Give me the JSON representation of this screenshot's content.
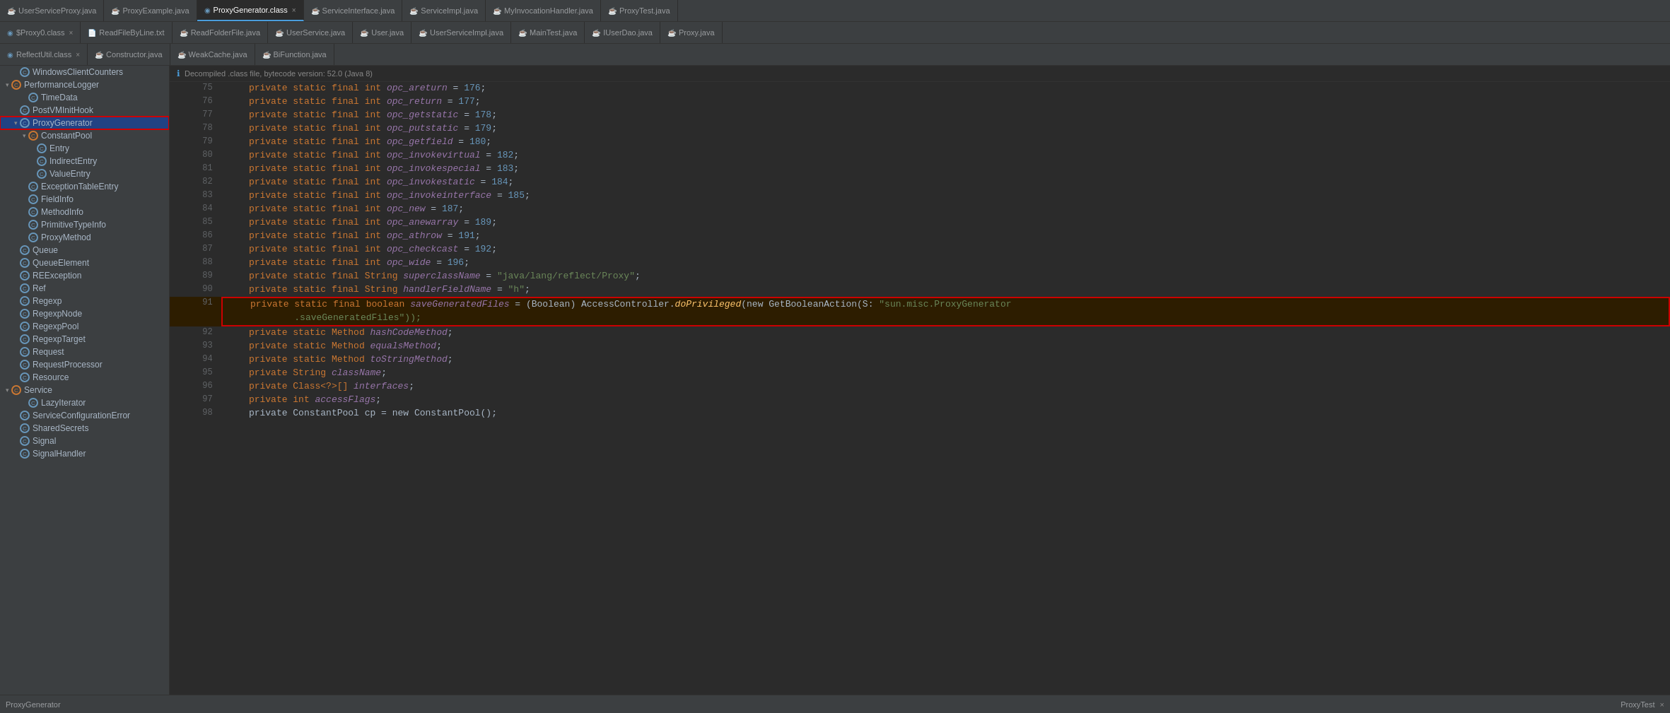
{
  "tabs_row1": [
    {
      "label": "UserServiceProxy.java",
      "icon": "java",
      "active": false,
      "closeable": false
    },
    {
      "label": "ProxyExample.java",
      "icon": "java",
      "active": false,
      "closeable": false
    },
    {
      "label": "ProxyGenerator.class",
      "icon": "class",
      "active": true,
      "closeable": true
    },
    {
      "label": "ServiceInterface.java",
      "icon": "java",
      "active": false,
      "closeable": false
    },
    {
      "label": "ServiceImpl.java",
      "icon": "java",
      "active": false,
      "closeable": false
    },
    {
      "label": "MyInvocationHandler.java",
      "icon": "java",
      "active": false,
      "closeable": false
    },
    {
      "label": "ProxyTest.java",
      "icon": "java",
      "active": false,
      "closeable": false
    }
  ],
  "tabs_row2": [
    {
      "label": "$Proxy0.class",
      "icon": "class",
      "active": false,
      "closeable": true
    },
    {
      "label": "ReadFileByLine.txt",
      "icon": "txt",
      "active": false,
      "closeable": false
    },
    {
      "label": "ReadFolderFile.java",
      "icon": "java",
      "active": false,
      "closeable": false
    },
    {
      "label": "UserService.java",
      "icon": "java",
      "active": false,
      "closeable": false
    },
    {
      "label": "User.java",
      "icon": "java",
      "active": false,
      "closeable": false
    },
    {
      "label": "UserServiceImpl.java",
      "icon": "java",
      "active": false,
      "closeable": false
    },
    {
      "label": "MainTest.java",
      "icon": "java",
      "active": false,
      "closeable": false
    },
    {
      "label": "IUserDao.java",
      "icon": "java",
      "active": false,
      "closeable": false
    },
    {
      "label": "Proxy.java",
      "icon": "java",
      "active": false,
      "closeable": false
    }
  ],
  "tabs_row3": [
    {
      "label": "ReflectUtil.class",
      "icon": "class",
      "active": false,
      "closeable": true
    },
    {
      "label": "Constructor.java",
      "icon": "java",
      "active": false,
      "closeable": false
    },
    {
      "label": "WeakCache.java",
      "icon": "java",
      "active": false,
      "closeable": false
    },
    {
      "label": "BiFunction.java",
      "icon": "java",
      "active": false,
      "closeable": false
    }
  ],
  "decompile_notice": "Decompiled .class file, bytecode version: 52.0 (Java 8)",
  "sidebar": {
    "items": [
      {
        "label": "WindowsClientCounters",
        "level": 1,
        "type": "class",
        "expanded": false
      },
      {
        "label": "PerformanceLogger",
        "level": 0,
        "type": "folder",
        "expanded": true
      },
      {
        "label": "TimeData",
        "level": 2,
        "type": "class",
        "expanded": false
      },
      {
        "label": "PostVMInitHook",
        "level": 1,
        "type": "class",
        "expanded": false
      },
      {
        "label": "ProxyGenerator",
        "level": 1,
        "type": "class",
        "expanded": true,
        "selected": true,
        "highlighted": true
      },
      {
        "label": "ConstantPool",
        "level": 2,
        "type": "folder",
        "expanded": true
      },
      {
        "label": "Entry",
        "level": 3,
        "type": "class",
        "expanded": false
      },
      {
        "label": "IndirectEntry",
        "level": 3,
        "type": "class",
        "expanded": false
      },
      {
        "label": "ValueEntry",
        "level": 3,
        "type": "class",
        "expanded": false
      },
      {
        "label": "ExceptionTableEntry",
        "level": 2,
        "type": "class",
        "expanded": false
      },
      {
        "label": "FieldInfo",
        "level": 2,
        "type": "class",
        "expanded": false
      },
      {
        "label": "MethodInfo",
        "level": 2,
        "type": "class",
        "expanded": false
      },
      {
        "label": "PrimitiveTypeInfo",
        "level": 2,
        "type": "class",
        "expanded": false
      },
      {
        "label": "ProxyMethod",
        "level": 2,
        "type": "class",
        "expanded": false
      },
      {
        "label": "Queue",
        "level": 1,
        "type": "class",
        "expanded": false
      },
      {
        "label": "QueueElement",
        "level": 1,
        "type": "class",
        "expanded": false
      },
      {
        "label": "REException",
        "level": 1,
        "type": "class",
        "expanded": false
      },
      {
        "label": "Ref",
        "level": 1,
        "type": "class",
        "expanded": false
      },
      {
        "label": "Regexp",
        "level": 1,
        "type": "class",
        "expanded": false
      },
      {
        "label": "RegexpNode",
        "level": 1,
        "type": "class",
        "expanded": false
      },
      {
        "label": "RegexpPool",
        "level": 1,
        "type": "class",
        "expanded": false
      },
      {
        "label": "RegexpTarget",
        "level": 1,
        "type": "class",
        "expanded": false
      },
      {
        "label": "Request",
        "level": 1,
        "type": "class",
        "expanded": false
      },
      {
        "label": "RequestProcessor",
        "level": 1,
        "type": "class",
        "expanded": false
      },
      {
        "label": "Resource",
        "level": 1,
        "type": "class",
        "expanded": false
      },
      {
        "label": "Service",
        "level": 0,
        "type": "folder",
        "expanded": true
      },
      {
        "label": "LazyIterator",
        "level": 2,
        "type": "class",
        "expanded": false
      },
      {
        "label": "ServiceConfigurationError",
        "level": 1,
        "type": "class",
        "expanded": false
      },
      {
        "label": "SharedSecrets",
        "level": 1,
        "type": "class",
        "expanded": false
      },
      {
        "label": "Signal",
        "level": 1,
        "type": "class",
        "expanded": false
      },
      {
        "label": "SignalHandler",
        "level": 1,
        "type": "class",
        "expanded": false
      }
    ]
  },
  "code_lines": [
    {
      "num": 75,
      "tokens": [
        {
          "t": "    private static final int ",
          "c": "kw"
        },
        {
          "t": "opc_areturn",
          "c": "field"
        },
        {
          "t": " = ",
          "c": ""
        },
        {
          "t": "176",
          "c": "num"
        },
        {
          "t": ";",
          "c": ""
        }
      ]
    },
    {
      "num": 76,
      "tokens": [
        {
          "t": "    private static final int ",
          "c": "kw"
        },
        {
          "t": "opc_return",
          "c": "field"
        },
        {
          "t": " = ",
          "c": ""
        },
        {
          "t": "177",
          "c": "num"
        },
        {
          "t": ";",
          "c": ""
        }
      ]
    },
    {
      "num": 77,
      "tokens": [
        {
          "t": "    private static final int ",
          "c": "kw"
        },
        {
          "t": "opc_getstatic",
          "c": "field"
        },
        {
          "t": " = ",
          "c": ""
        },
        {
          "t": "178",
          "c": "num"
        },
        {
          "t": ";",
          "c": ""
        }
      ]
    },
    {
      "num": 78,
      "tokens": [
        {
          "t": "    private static final int ",
          "c": "kw"
        },
        {
          "t": "opc_putstatic",
          "c": "field"
        },
        {
          "t": " = ",
          "c": ""
        },
        {
          "t": "179",
          "c": "num"
        },
        {
          "t": ";",
          "c": ""
        }
      ]
    },
    {
      "num": 79,
      "tokens": [
        {
          "t": "    private static final int ",
          "c": "kw"
        },
        {
          "t": "opc_getfield",
          "c": "field"
        },
        {
          "t": " = ",
          "c": ""
        },
        {
          "t": "180",
          "c": "num"
        },
        {
          "t": ";",
          "c": ""
        }
      ]
    },
    {
      "num": 80,
      "tokens": [
        {
          "t": "    private static final int ",
          "c": "kw"
        },
        {
          "t": "opc_invokevirtual",
          "c": "field"
        },
        {
          "t": " = ",
          "c": ""
        },
        {
          "t": "182",
          "c": "num"
        },
        {
          "t": ";",
          "c": ""
        }
      ]
    },
    {
      "num": 81,
      "tokens": [
        {
          "t": "    private static final int ",
          "c": "kw"
        },
        {
          "t": "opc_invokespecial",
          "c": "field"
        },
        {
          "t": " = ",
          "c": ""
        },
        {
          "t": "183",
          "c": "num"
        },
        {
          "t": ";",
          "c": ""
        }
      ]
    },
    {
      "num": 82,
      "tokens": [
        {
          "t": "    private static final int ",
          "c": "kw"
        },
        {
          "t": "opc_invokestatic",
          "c": "field"
        },
        {
          "t": " = ",
          "c": ""
        },
        {
          "t": "184",
          "c": "num"
        },
        {
          "t": ";",
          "c": ""
        }
      ]
    },
    {
      "num": 83,
      "tokens": [
        {
          "t": "    private static final int ",
          "c": "kw"
        },
        {
          "t": "opc_invokeinterface",
          "c": "field"
        },
        {
          "t": " = ",
          "c": ""
        },
        {
          "t": "185",
          "c": "num"
        },
        {
          "t": ";",
          "c": ""
        }
      ]
    },
    {
      "num": 84,
      "tokens": [
        {
          "t": "    private static final int ",
          "c": "kw"
        },
        {
          "t": "opc_new",
          "c": "field"
        },
        {
          "t": " = ",
          "c": ""
        },
        {
          "t": "187",
          "c": "num"
        },
        {
          "t": ";",
          "c": ""
        }
      ]
    },
    {
      "num": 85,
      "tokens": [
        {
          "t": "    private static final int ",
          "c": "kw"
        },
        {
          "t": "opc_anewarray",
          "c": "field"
        },
        {
          "t": " = ",
          "c": ""
        },
        {
          "t": "189",
          "c": "num"
        },
        {
          "t": ";",
          "c": ""
        }
      ]
    },
    {
      "num": 86,
      "tokens": [
        {
          "t": "    private static final int ",
          "c": "kw"
        },
        {
          "t": "opc_athrow",
          "c": "field"
        },
        {
          "t": " = ",
          "c": ""
        },
        {
          "t": "191",
          "c": "num"
        },
        {
          "t": ";",
          "c": ""
        }
      ]
    },
    {
      "num": 87,
      "tokens": [
        {
          "t": "    private static final int ",
          "c": "kw"
        },
        {
          "t": "opc_checkcast",
          "c": "field"
        },
        {
          "t": " = ",
          "c": ""
        },
        {
          "t": "192",
          "c": "num"
        },
        {
          "t": ";",
          "c": ""
        }
      ]
    },
    {
      "num": 88,
      "tokens": [
        {
          "t": "    private static final int ",
          "c": "kw"
        },
        {
          "t": "opc_wide",
          "c": "field"
        },
        {
          "t": " = ",
          "c": ""
        },
        {
          "t": "196",
          "c": "num"
        },
        {
          "t": ";",
          "c": ""
        }
      ]
    },
    {
      "num": 89,
      "tokens": [
        {
          "t": "    private static final String ",
          "c": "kw"
        },
        {
          "t": "superclassName",
          "c": "field"
        },
        {
          "t": " = ",
          "c": ""
        },
        {
          "t": "\"java/lang/reflect/Proxy\"",
          "c": "str"
        },
        {
          "t": ";",
          "c": ""
        }
      ]
    },
    {
      "num": 90,
      "tokens": [
        {
          "t": "    private static final String ",
          "c": "kw"
        },
        {
          "t": "handlerFieldName",
          "c": "field"
        },
        {
          "t": " = ",
          "c": ""
        },
        {
          "t": "\"h\"",
          "c": "str"
        },
        {
          "t": ";",
          "c": ""
        }
      ]
    },
    {
      "num": 91,
      "tokens": [
        {
          "t": "    private static final boolean ",
          "c": "kw"
        },
        {
          "t": "saveGeneratedFiles",
          "c": "field"
        },
        {
          "t": " = (Boolean) AccessController.",
          "c": ""
        },
        {
          "t": "doPrivileged",
          "c": "method"
        },
        {
          "t": "(new GetBooleanAction(S: ",
          "c": ""
        },
        {
          "t": "\"sun.misc.ProxyGenerator",
          "c": "str"
        },
        {
          "t": "\n        .saveGeneratedFiles\"));",
          "c": "str"
        }
      ],
      "highlighted": true
    },
    {
      "num": 92,
      "tokens": [
        {
          "t": "    private static Method ",
          "c": "kw"
        },
        {
          "t": "hashCodeMethod",
          "c": "field"
        },
        {
          "t": ";",
          "c": ""
        }
      ]
    },
    {
      "num": 93,
      "tokens": [
        {
          "t": "    private static Method ",
          "c": "kw"
        },
        {
          "t": "equalsMethod",
          "c": "field"
        },
        {
          "t": ";",
          "c": ""
        }
      ]
    },
    {
      "num": 94,
      "tokens": [
        {
          "t": "    private static Method ",
          "c": "kw"
        },
        {
          "t": "toStringMethod",
          "c": "field"
        },
        {
          "t": ";",
          "c": ""
        }
      ]
    },
    {
      "num": 95,
      "tokens": [
        {
          "t": "    private String ",
          "c": "kw"
        },
        {
          "t": "className",
          "c": "field"
        },
        {
          "t": ";",
          "c": ""
        }
      ]
    },
    {
      "num": 96,
      "tokens": [
        {
          "t": "    private Class<?>[] ",
          "c": "kw"
        },
        {
          "t": "interfaces",
          "c": "field"
        },
        {
          "t": ";",
          "c": ""
        }
      ]
    },
    {
      "num": 97,
      "tokens": [
        {
          "t": "    private int ",
          "c": "kw"
        },
        {
          "t": "accessFlags",
          "c": "field"
        },
        {
          "t": ";",
          "c": ""
        }
      ]
    },
    {
      "num": 98,
      "tokens": [
        {
          "t": "    private ConstantPool cp = new ConstantPool();",
          "c": ""
        }
      ]
    }
  ],
  "bottom_bar": {
    "filename": "ProxyGenerator",
    "tab_label": "ProxyTest",
    "close_label": "×"
  }
}
